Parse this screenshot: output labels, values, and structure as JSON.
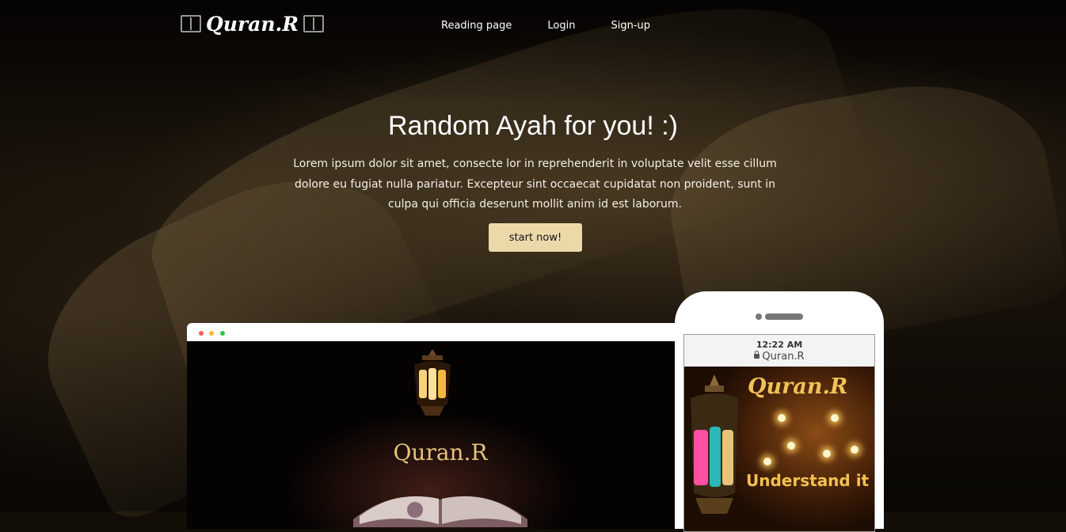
{
  "nav": {
    "brand": "Quran.R",
    "links": [
      "Reading page",
      "Login",
      "Sign-up"
    ]
  },
  "hero": {
    "title": "Random Ayah for you! :)",
    "text": "Lorem ipsum dolor sit amet, consecte lor in reprehenderit in voluptate velit esse cillum dolore eu fugiat nulla pariatur. Excepteur sint occaecat cupidatat non proident, sunt in culpa qui officia deserunt mollit anim id est laborum.",
    "cta": "start now!"
  },
  "desktop_mockup": {
    "brand": "Quran.R"
  },
  "phone_mockup": {
    "time": "12:22 AM",
    "url": "Quran.R",
    "brand": "Quran.R",
    "tagline": "Understand it"
  },
  "colors": {
    "accent": "#ecd9aa",
    "gold": "#e6c27a",
    "dot_red": "#ff5f57",
    "dot_yellow": "#febc2e",
    "dot_green": "#28c840"
  }
}
